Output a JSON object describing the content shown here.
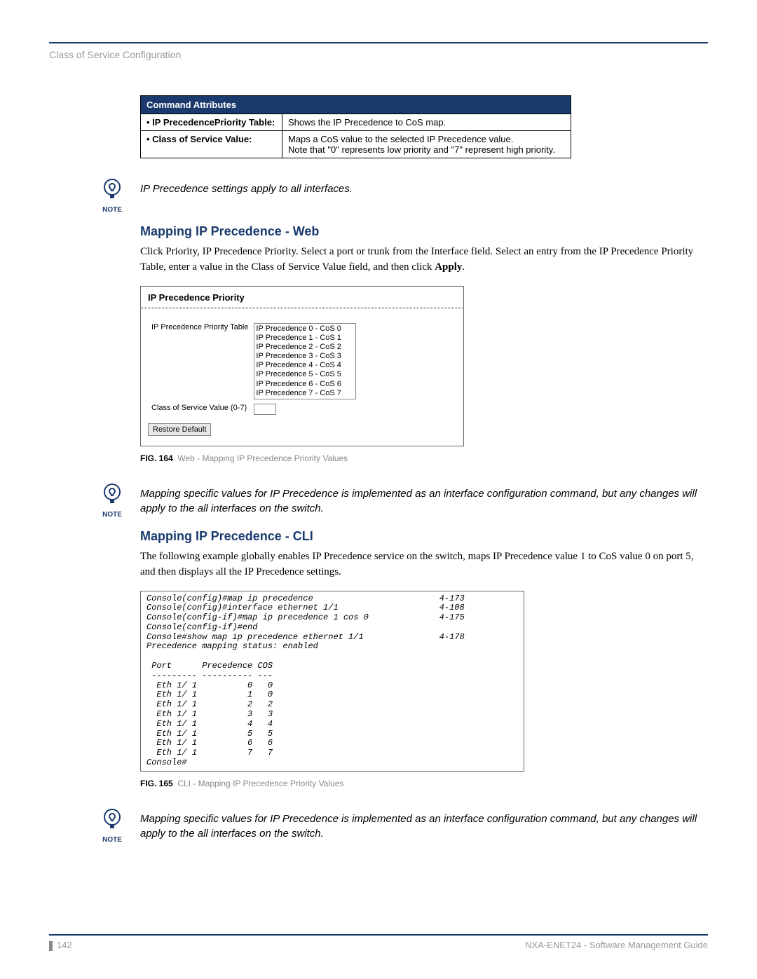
{
  "header": {
    "section_title": "Class of Service Configuration"
  },
  "cmd_table": {
    "header": "Command Attributes",
    "rows": [
      {
        "label": "• IP PrecedencePriority Table:",
        "desc": "Shows the IP Precedence to CoS map."
      },
      {
        "label": "• Class of Service Value:",
        "desc": "Maps a CoS value to the selected IP Precedence value.\nNote that \"0\" represents low priority and \"7\" represent high priority."
      }
    ]
  },
  "note1": "IP Precedence settings apply to all interfaces.",
  "note_label": "NOTE",
  "section_web": {
    "title": "Mapping IP Precedence - Web",
    "body": "Click Priority, IP Precedence Priority. Select a port or trunk from the Interface field. Select an entry from the IP Precedence Priority Table, enter a value in the Class of Service Value field, and then click Apply."
  },
  "screenshot": {
    "title": "IP Precedence Priority",
    "row1_label": "IP Precedence Priority Table",
    "list_items": [
      "IP Precedence 0 - CoS 0",
      "IP Precedence 1 - CoS 1",
      "IP Precedence 2 - CoS 2",
      "IP Precedence 3 - CoS 3",
      "IP Precedence 4 - CoS 4",
      "IP Precedence 5 - CoS 5",
      "IP Precedence 6 - CoS 6",
      "IP Precedence 7 - CoS 7"
    ],
    "row2_label": "Class of Service Value (0-7)",
    "button": "Restore Default"
  },
  "fig164": {
    "num": "FIG. 164",
    "caption": "Web - Mapping IP Precedence Priority Values"
  },
  "note2": "Mapping specific values for IP Precedence is implemented as an interface configuration command, but any changes will apply to the all interfaces on the switch.",
  "section_cli": {
    "title": "Mapping IP Precedence - CLI",
    "body": "The following example globally enables IP Precedence service on the switch, maps IP Precedence value 1 to CoS value 0 on port 5, and then displays all the IP Precedence settings."
  },
  "cli_lines": [
    {
      "text": "Console(config)#map ip precedence",
      "ref": "4-173"
    },
    {
      "text": "Console(config)#interface ethernet 1/1",
      "ref": "4-108"
    },
    {
      "text": "Console(config-if)#map ip precedence 1 cos 0",
      "ref": "4-175"
    },
    {
      "text": "Console(config-if)#end",
      "ref": ""
    },
    {
      "text": "Console#show map ip precedence ethernet 1/1",
      "ref": "4-178"
    },
    {
      "text": "Precedence mapping status: enabled",
      "ref": ""
    },
    {
      "text": "",
      "ref": ""
    },
    {
      "text": " Port      Precedence COS",
      "ref": ""
    },
    {
      "text": " --------- ---------- ---",
      "ref": ""
    },
    {
      "text": "  Eth 1/ 1          0   0",
      "ref": ""
    },
    {
      "text": "  Eth 1/ 1          1   0",
      "ref": ""
    },
    {
      "text": "  Eth 1/ 1          2   2",
      "ref": ""
    },
    {
      "text": "  Eth 1/ 1          3   3",
      "ref": ""
    },
    {
      "text": "  Eth 1/ 1          4   4",
      "ref": ""
    },
    {
      "text": "  Eth 1/ 1          5   5",
      "ref": ""
    },
    {
      "text": "  Eth 1/ 1          6   6",
      "ref": ""
    },
    {
      "text": "  Eth 1/ 1          7   7",
      "ref": ""
    },
    {
      "text": "Console#",
      "ref": ""
    }
  ],
  "fig165": {
    "num": "FIG. 165",
    "caption": "CLI - Mapping IP Precedence Priority Values"
  },
  "note3": "Mapping specific values for IP Precedence is implemented as an interface configuration command, but any changes will apply to the all interfaces on the switch.",
  "footer": {
    "page": "142",
    "doc": "NXA-ENET24 - Software Management Guide"
  }
}
